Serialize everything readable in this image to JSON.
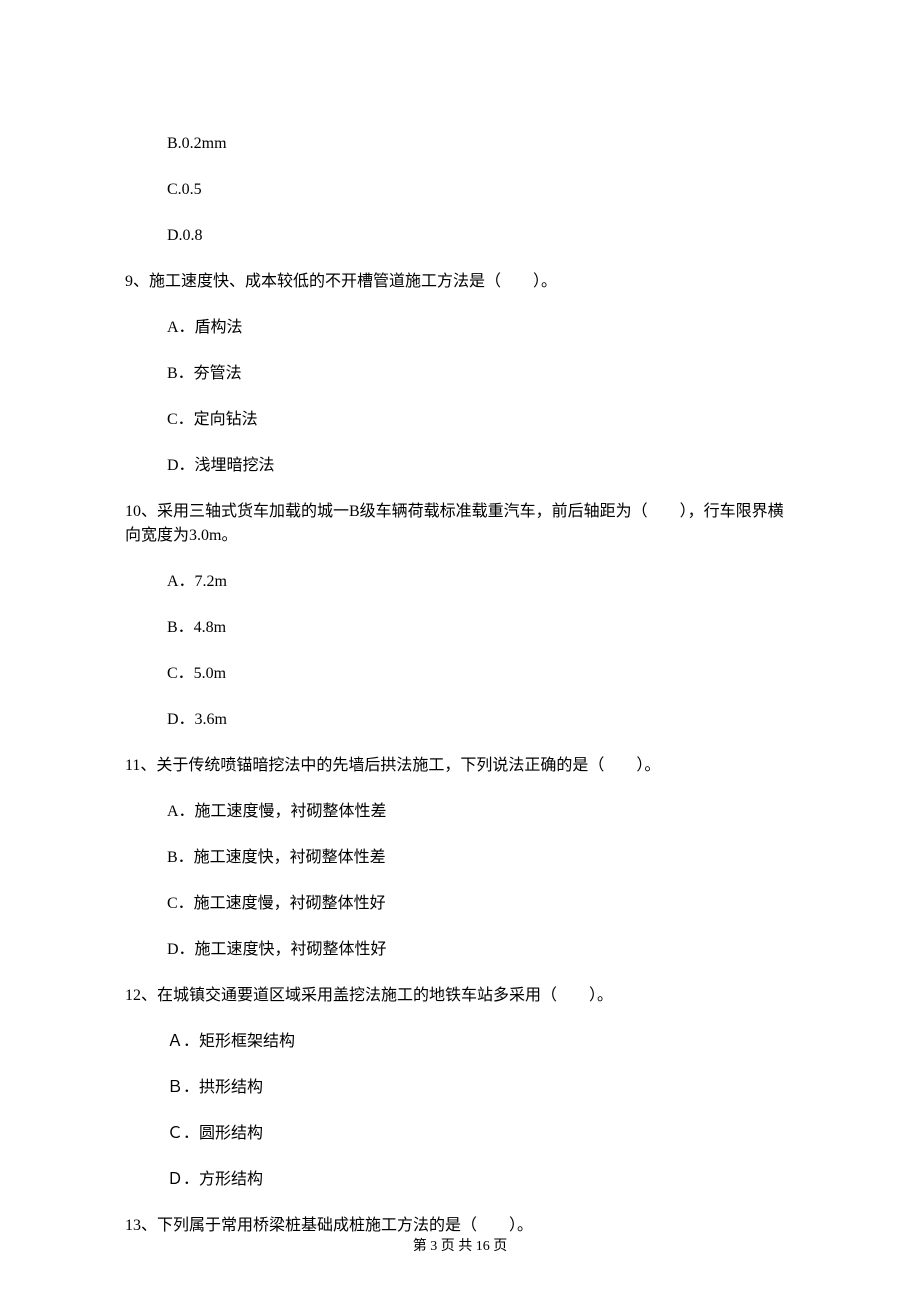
{
  "options_top": [
    "B.0.2mm",
    "C.0.5",
    "D.0.8"
  ],
  "q9": {
    "text": "9、施工速度快、成本较低的不开槽管道施工方法是（　　）。",
    "options": [
      "A．盾构法",
      "B．夯管法",
      "C．定向钻法",
      "D．浅埋暗挖法"
    ]
  },
  "q10": {
    "text": "10、采用三轴式货车加载的城一B级车辆荷载标准载重汽车，前后轴距为（　　），行车限界横向宽度为3.0m。",
    "options": [
      "A．7.2m",
      "B．4.8m",
      "C．5.0m",
      "D．3.6m"
    ]
  },
  "q11": {
    "text": "11、关于传统喷锚暗挖法中的先墙后拱法施工，下列说法正确的是（　　）。",
    "options": [
      "A．施工速度慢，衬砌整体性差",
      "B．施工速度快，衬砌整体性差",
      "C．施工速度慢，衬砌整体性好",
      "D．施工速度快，衬砌整体性好"
    ]
  },
  "q12": {
    "text": "12、在城镇交通要道区域采用盖挖法施工的地铁车站多采用（　　）。",
    "options": [
      "Ａ．矩形框架结构",
      "Ｂ．拱形结构",
      "Ｃ．圆形结构",
      "Ｄ．方形结构"
    ]
  },
  "q13": {
    "text": "13、下列属于常用桥梁桩基础成桩施工方法的是（　　）。"
  },
  "footer": "第 3 页 共 16 页"
}
